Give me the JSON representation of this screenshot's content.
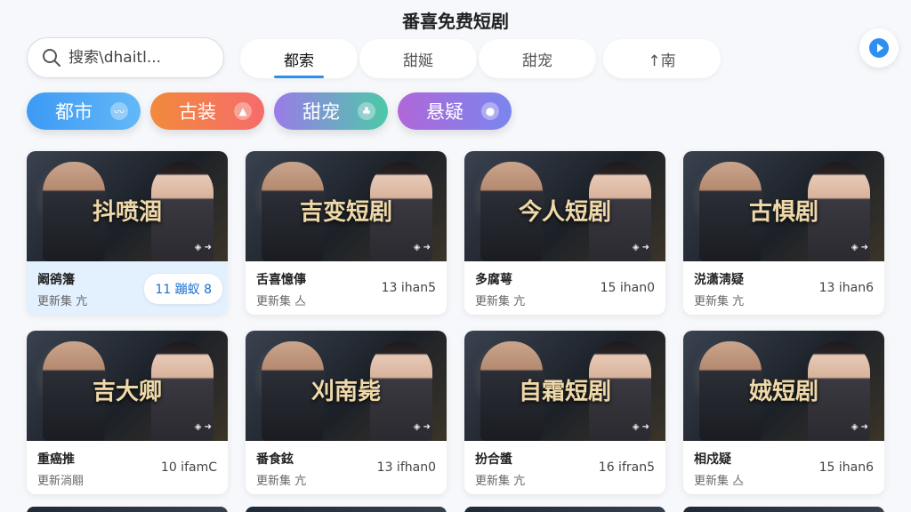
{
  "app_title": "番喜免费短剧",
  "search": {
    "placeholder": "搜索\\dhaitl..."
  },
  "tabs": [
    {
      "label": "都索",
      "active": true
    },
    {
      "label": "甜娫",
      "active": false
    },
    {
      "label": "甜宠",
      "active": false
    },
    {
      "label": "↑南",
      "active": false
    }
  ],
  "genres": [
    {
      "label": "都市",
      "icon": "wave-icon",
      "color_from": "#3d9af5",
      "color_to": "#62b8f7"
    },
    {
      "label": "古装",
      "icon": "flame-icon",
      "color_from": "#f28a3c",
      "color_to": "#f66b6b"
    },
    {
      "label": "甜宠",
      "icon": "leaf-icon",
      "color_from": "#9b7be8",
      "color_to": "#4cc9a8"
    },
    {
      "label": "悬疑",
      "icon": "orb-icon",
      "color_from": "#b067d8",
      "color_to": "#7a86ef"
    }
  ],
  "cards": [
    {
      "poster_title": "抖喷涸",
      "name": "阚鹆籓",
      "sub": "更新集 亢",
      "episodes": "11 蹦蚁 8",
      "highlighted": true
    },
    {
      "poster_title": "吉变短剧",
      "name": "舌喜憶倳",
      "sub": "更新集 亼",
      "episodes": "13 ihan5",
      "highlighted": false
    },
    {
      "poster_title": "今人短剧",
      "name": "多腐萼",
      "sub": "更新集 亢",
      "episodes": "15 ihan0",
      "highlighted": false
    },
    {
      "poster_title": "古惧剧",
      "name": "涚潇淸疑",
      "sub": "更新集 亢",
      "episodes": "13 ihan6",
      "highlighted": false
    },
    {
      "poster_title": "吉大卿",
      "name": "重癌推",
      "sub": "更新淌翢",
      "episodes": "10 ifamC",
      "highlighted": false
    },
    {
      "poster_title": "刈南毙",
      "name": "番食鉉",
      "sub": "更新集 亢",
      "episodes": "13 ifhan0",
      "highlighted": false
    },
    {
      "poster_title": "自霜短剧",
      "name": "扮合螿",
      "sub": "更新集 亢",
      "episodes": "16 ifran5",
      "highlighted": false
    },
    {
      "poster_title": "娀短剧",
      "name": "相戍疑",
      "sub": "更新集 亼",
      "episodes": "15 ihan6",
      "highlighted": false
    }
  ],
  "colors": {
    "accent": "#2d8ff0",
    "play": "#2d8ff0"
  }
}
